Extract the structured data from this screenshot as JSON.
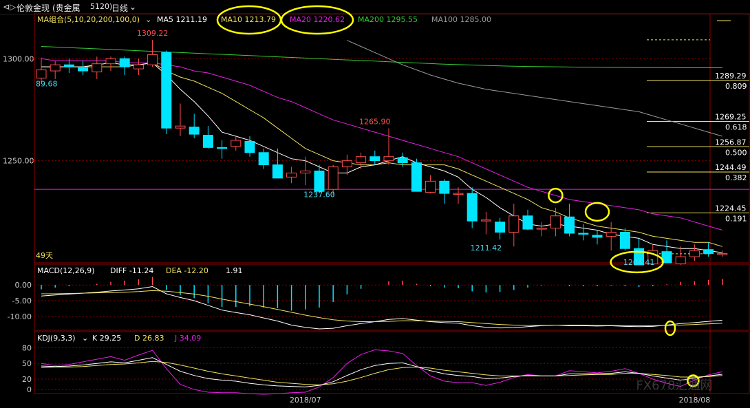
{
  "toolbar": {
    "back_label": "⊲▷",
    "instrument": "伦敦金现",
    "category": "(贵金属",
    "code": "5120)",
    "period_label": "日线",
    "chevron": "⌄"
  },
  "colors": {
    "background": "#000000",
    "grid": "#8b0000",
    "up": "#ff4d4d",
    "down": "#00e5ff",
    "ma5": "#ffffff",
    "ma10": "#f2e35b",
    "ma20": "#e51fe5",
    "ma200": "#33cc33",
    "ma100": "#9a9a9a",
    "fib": "#f2e35b",
    "highlight": "#ffff00"
  },
  "chart_data": [
    {
      "type": "candlestick",
      "title": "MA组合(5,10,20,200,100,0)",
      "title_chevron": "⌄",
      "ylim": [
        1200,
        1322
      ],
      "y_ticks": [
        "1300.00",
        "1250.00"
      ],
      "ma_labels": [
        {
          "name": "MA5",
          "value": "1211.19"
        },
        {
          "name": "MA10",
          "value": "1213.79"
        },
        {
          "name": "MA20",
          "value": "1220.62"
        },
        {
          "name": "MA200",
          "value": "1295.55"
        },
        {
          "name": "MA100",
          "value": "1285.00"
        }
      ],
      "annotations": [
        {
          "text": "1309.22",
          "x": 8,
          "y": 1309.22
        },
        {
          "text": "1265.90",
          "x": 24,
          "y": 1265.9
        },
        {
          "text": "1237.60",
          "x": 20,
          "y": 1237.6
        },
        {
          "text": "1211.42",
          "x": 32,
          "y": 1211.42
        },
        {
          "text": "1204.41",
          "x": 43,
          "y": 1204.41
        },
        {
          "text": "89.68",
          "x": 0,
          "y": 1290.5
        },
        {
          "text": "49天",
          "x": 0,
          "y": 1203
        }
      ],
      "candles": [
        {
          "o": 1290.5,
          "h": 1300.5,
          "l": 1288,
          "c": 1294.5
        },
        {
          "o": 1294,
          "h": 1299,
          "l": 1290,
          "c": 1297
        },
        {
          "o": 1297,
          "h": 1300,
          "l": 1293,
          "c": 1296
        },
        {
          "o": 1295.5,
          "h": 1299,
          "l": 1292,
          "c": 1294
        },
        {
          "o": 1293.5,
          "h": 1301,
          "l": 1290,
          "c": 1297.5
        },
        {
          "o": 1297.5,
          "h": 1301,
          "l": 1294,
          "c": 1300
        },
        {
          "o": 1300,
          "h": 1301,
          "l": 1292,
          "c": 1296
        },
        {
          "o": 1295,
          "h": 1300,
          "l": 1292,
          "c": 1297
        },
        {
          "o": 1297,
          "h": 1309.22,
          "l": 1296,
          "c": 1302
        },
        {
          "o": 1303,
          "h": 1304,
          "l": 1263,
          "c": 1266
        },
        {
          "o": 1266,
          "h": 1278,
          "l": 1262,
          "c": 1267
        },
        {
          "o": 1266.5,
          "h": 1273,
          "l": 1261,
          "c": 1263
        },
        {
          "o": 1262.5,
          "h": 1267,
          "l": 1256,
          "c": 1256.5
        },
        {
          "o": 1256.5,
          "h": 1260,
          "l": 1251,
          "c": 1256
        },
        {
          "o": 1257,
          "h": 1262,
          "l": 1255,
          "c": 1260
        },
        {
          "o": 1259.5,
          "h": 1262,
          "l": 1252,
          "c": 1254
        },
        {
          "o": 1254,
          "h": 1256,
          "l": 1246,
          "c": 1248
        },
        {
          "o": 1248,
          "h": 1256,
          "l": 1242,
          "c": 1241.5
        },
        {
          "o": 1242,
          "h": 1247,
          "l": 1239,
          "c": 1244
        },
        {
          "o": 1244,
          "h": 1252,
          "l": 1238,
          "c": 1245
        },
        {
          "o": 1245,
          "h": 1248,
          "l": 1234,
          "c": 1235
        },
        {
          "o": 1236,
          "h": 1248,
          "l": 1233,
          "c": 1247
        },
        {
          "o": 1247,
          "h": 1253,
          "l": 1243,
          "c": 1250
        },
        {
          "o": 1249,
          "h": 1254,
          "l": 1246,
          "c": 1252
        },
        {
          "o": 1252,
          "h": 1255,
          "l": 1248,
          "c": 1250
        },
        {
          "o": 1250,
          "h": 1265.9,
          "l": 1248,
          "c": 1252
        },
        {
          "o": 1251.5,
          "h": 1254,
          "l": 1247,
          "c": 1249
        },
        {
          "o": 1249,
          "h": 1251,
          "l": 1235,
          "c": 1235
        },
        {
          "o": 1234.5,
          "h": 1243,
          "l": 1234,
          "c": 1240
        },
        {
          "o": 1240,
          "h": 1241,
          "l": 1229,
          "c": 1234
        },
        {
          "o": 1233.5,
          "h": 1237,
          "l": 1229,
          "c": 1234
        },
        {
          "o": 1234,
          "h": 1237,
          "l": 1217,
          "c": 1220.5
        },
        {
          "o": 1220.5,
          "h": 1225,
          "l": 1214,
          "c": 1221
        },
        {
          "o": 1220,
          "h": 1222,
          "l": 1211.42,
          "c": 1215
        },
        {
          "o": 1215,
          "h": 1229,
          "l": 1208,
          "c": 1223
        },
        {
          "o": 1223,
          "h": 1226,
          "l": 1216,
          "c": 1216.5
        },
        {
          "o": 1216.5,
          "h": 1220,
          "l": 1213,
          "c": 1217
        },
        {
          "o": 1217,
          "h": 1227,
          "l": 1213,
          "c": 1223
        },
        {
          "o": 1222.5,
          "h": 1229,
          "l": 1213,
          "c": 1214.5
        },
        {
          "o": 1214.5,
          "h": 1219,
          "l": 1211,
          "c": 1214
        },
        {
          "o": 1213.5,
          "h": 1216,
          "l": 1209,
          "c": 1212.5
        },
        {
          "o": 1213,
          "h": 1220,
          "l": 1206,
          "c": 1215
        },
        {
          "o": 1215,
          "h": 1217,
          "l": 1206,
          "c": 1207
        },
        {
          "o": 1207,
          "h": 1212,
          "l": 1206,
          "c": 1199
        },
        {
          "o": 1199.5,
          "h": 1209,
          "l": 1203,
          "c": 1206
        },
        {
          "o": 1205.5,
          "h": 1211,
          "l": 1204.41,
          "c": 1200
        },
        {
          "o": 1199.5,
          "h": 1208,
          "l": 1199,
          "c": 1203
        },
        {
          "o": 1203,
          "h": 1209,
          "l": 1201,
          "c": 1206
        },
        {
          "o": 1206.5,
          "h": 1210,
          "l": 1203,
          "c": 1204.5
        },
        {
          "o": 1204,
          "h": 1206,
          "l": 1203,
          "c": 1204.5
        }
      ],
      "ma_lines": {
        "MA5": [
          1296,
          1296,
          1296,
          1296,
          1297,
          1298,
          1297,
          1297,
          1298,
          1292,
          1285,
          1279,
          1272,
          1264,
          1262,
          1260,
          1257,
          1254,
          1251,
          1250,
          1247,
          1244,
          1244,
          1247,
          1248,
          1250,
          1252,
          1249,
          1247,
          1245,
          1242,
          1236,
          1232,
          1227,
          1223,
          1219,
          1218,
          1219,
          1218,
          1217,
          1216,
          1214,
          1213,
          1212,
          1209,
          1208,
          1207,
          1207,
          1206,
          1205
        ],
        "MA10": [
          1296,
          1296,
          1296,
          1296,
          1296,
          1296,
          1296,
          1297,
          1298,
          1294,
          1291,
          1289,
          1286,
          1283,
          1279,
          1275,
          1271,
          1266,
          1261,
          1256,
          1253,
          1250,
          1249,
          1248,
          1248,
          1249,
          1248,
          1248,
          1248,
          1248,
          1246,
          1243,
          1240,
          1237,
          1234,
          1231,
          1227,
          1225,
          1222,
          1220,
          1218,
          1217,
          1216,
          1215,
          1213,
          1212,
          1211,
          1210,
          1210,
          1208
        ],
        "MA20": [
          1300,
          1299,
          1299,
          1299,
          1299,
          1299,
          1298,
          1298,
          1298,
          1297,
          1296,
          1294,
          1293,
          1291,
          1289,
          1287,
          1284,
          1281,
          1279,
          1276,
          1273,
          1270,
          1268,
          1266,
          1264,
          1262,
          1260,
          1258,
          1256,
          1254,
          1252,
          1249,
          1246,
          1243,
          1240,
          1237,
          1235,
          1233,
          1231,
          1230,
          1229,
          1228,
          1227,
          1226,
          1224,
          1223,
          1222,
          1220,
          1218,
          1216
        ],
        "MA200": [
          1306,
          1305.7,
          1305.4,
          1305.1,
          1304.8,
          1304.5,
          1304.2,
          1303.9,
          1303.6,
          1303.3,
          1303,
          1302.7,
          1302.4,
          1302.1,
          1301.8,
          1301.5,
          1301.2,
          1300.9,
          1300.6,
          1300.3,
          1300,
          1299.7,
          1299.4,
          1299.1,
          1298.8,
          1298.5,
          1298.2,
          1297.9,
          1297.6,
          1297.3,
          1297.1,
          1296.9,
          1296.7,
          1296.5,
          1296.3,
          1296.2,
          1296.1,
          1296,
          1295.9,
          1295.8,
          1295.8,
          1295.7,
          1295.7,
          1295.6,
          1295.6,
          1295.6,
          1295.55,
          1295.55,
          1295.55,
          1295.55
        ],
        "MA100": [
          null,
          null,
          null,
          null,
          null,
          null,
          null,
          null,
          null,
          null,
          null,
          null,
          null,
          null,
          null,
          null,
          null,
          null,
          null,
          null,
          null,
          null,
          1309,
          1306,
          1303,
          1300,
          1297,
          1294.5,
          1292,
          1290,
          1288,
          1286.5,
          1285,
          1284,
          1283,
          1282,
          1281,
          1280,
          1279,
          1278,
          1277,
          1276,
          1275,
          1274,
          1272,
          1270,
          1268,
          1266,
          1264,
          1262
        ]
      },
      "horizontal_line": {
        "y": 1236,
        "color": "#e51fe5"
      },
      "fib_levels": [
        {
          "price": "1289.29",
          "ratio": "0.809",
          "y": 1289.29
        },
        {
          "price": "1269.25",
          "ratio": "0.618",
          "y": 1269.25
        },
        {
          "price": "1256.87",
          "ratio": "0.500",
          "y": 1256.87
        },
        {
          "price": "1244.49",
          "ratio": "0.382",
          "y": 1244.49
        },
        {
          "price": "1224.45",
          "ratio": "0.191",
          "y": 1224.45
        }
      ],
      "fib_dashed": [
        1309.22,
        1204.41
      ],
      "highlights": [
        {
          "x": 37,
          "y": 1233
        },
        {
          "x": 40,
          "y": 1225
        },
        {
          "x": 43,
          "y": 1202
        }
      ]
    },
    {
      "type": "line",
      "title": "MACD(12,26,9)",
      "series_labels": [
        {
          "name": "DIFF",
          "value": "-11.24"
        },
        {
          "name": "DEA",
          "value": "-12.20"
        },
        {
          "name": "",
          "value": "1.91"
        }
      ],
      "ylim": [
        -14,
        4
      ],
      "y_ticks": [
        "0.00",
        "-5.00",
        "-10.00"
      ],
      "y_tick_values": [
        0,
        -5,
        -10
      ],
      "diff": [
        -3.5,
        -3.2,
        -2.9,
        -2.6,
        -2.3,
        -1.9,
        -1.6,
        -1.2,
        -0.5,
        -2.8,
        -4.0,
        -5.0,
        -6.5,
        -8.0,
        -8.8,
        -9.5,
        -10.5,
        -11.5,
        -12.8,
        -13.5,
        -14.0,
        -13.8,
        -13.0,
        -12.3,
        -11.7,
        -11.0,
        -10.7,
        -11.2,
        -11.7,
        -12.0,
        -12.2,
        -13.0,
        -13.5,
        -13.7,
        -13.6,
        -13.3,
        -13.0,
        -12.8,
        -13.0,
        -13.0,
        -13.1,
        -13.0,
        -13.2,
        -13.3,
        -13.2,
        -12.8,
        -12.3,
        -12.0,
        -11.6,
        -11.24
      ],
      "dea": [
        -2.8,
        -2.8,
        -2.7,
        -2.6,
        -2.5,
        -2.4,
        -2.3,
        -2.1,
        -1.8,
        -2.0,
        -2.4,
        -2.9,
        -3.6,
        -4.5,
        -5.3,
        -6.1,
        -6.9,
        -7.8,
        -8.7,
        -9.6,
        -10.4,
        -11.1,
        -11.5,
        -11.7,
        -11.7,
        -11.6,
        -11.4,
        -11.4,
        -11.5,
        -11.6,
        -11.7,
        -12.0,
        -12.3,
        -12.6,
        -12.8,
        -12.9,
        -12.9,
        -12.8,
        -12.8,
        -12.8,
        -12.9,
        -12.9,
        -13.0,
        -13.0,
        -13.0,
        -12.9,
        -12.8,
        -12.6,
        -12.4,
        -12.2
      ],
      "highlight": {
        "x": 45,
        "y": -13.5
      }
    },
    {
      "type": "line",
      "title": "KDJ(9,3,3)",
      "series_labels": [
        {
          "name": "K",
          "value": "29.25"
        },
        {
          "name": "D",
          "value": "26.83"
        },
        {
          "name": "J",
          "value": "34.09"
        }
      ],
      "ylim": [
        -5,
        95
      ],
      "y_ticks": [
        "80",
        "50",
        "20",
        "0"
      ],
      "y_tick_values": [
        80,
        50,
        20,
        0
      ],
      "k": [
        45,
        44,
        45,
        47,
        50,
        53,
        51,
        56,
        61,
        48,
        35,
        27,
        21,
        18,
        16,
        12,
        9,
        7,
        6,
        5,
        8,
        15,
        27,
        38,
        46,
        50,
        51,
        44,
        36,
        30,
        27,
        25,
        21,
        22,
        25,
        27,
        26,
        26,
        30,
        30,
        30,
        31,
        34,
        31,
        26,
        22,
        18,
        22,
        26,
        29.25
      ],
      "d": [
        42,
        43,
        43,
        44,
        46,
        48,
        49,
        51,
        54,
        52,
        47,
        41,
        35,
        30,
        26,
        22,
        18,
        14,
        12,
        10,
        9,
        11,
        16,
        23,
        31,
        38,
        42,
        43,
        41,
        37,
        34,
        31,
        28,
        26,
        26,
        26,
        26,
        26,
        27,
        28,
        29,
        29,
        31,
        31,
        29,
        27,
        24,
        24,
        25,
        26.83
      ],
      "j": [
        50,
        46,
        48,
        53,
        58,
        63,
        56,
        66,
        75,
        40,
        10,
        0,
        -5,
        -6,
        -6,
        -8,
        -9,
        -8,
        -6,
        -5,
        5,
        23,
        50,
        67,
        76,
        74,
        69,
        46,
        26,
        16,
        13,
        13,
        8,
        14,
        23,
        29,
        26,
        26,
        36,
        34,
        32,
        35,
        40,
        31,
        20,
        12,
        6,
        18,
        28,
        34.09
      ],
      "highlight": {
        "x": 47,
        "y": 22
      }
    }
  ],
  "x_axis": {
    "labels": [
      {
        "text": "2018/07",
        "x": 19
      },
      {
        "text": "2018/08",
        "x": 47
      }
    ]
  },
  "watermark": {
    "text": "FX678汇通网"
  }
}
